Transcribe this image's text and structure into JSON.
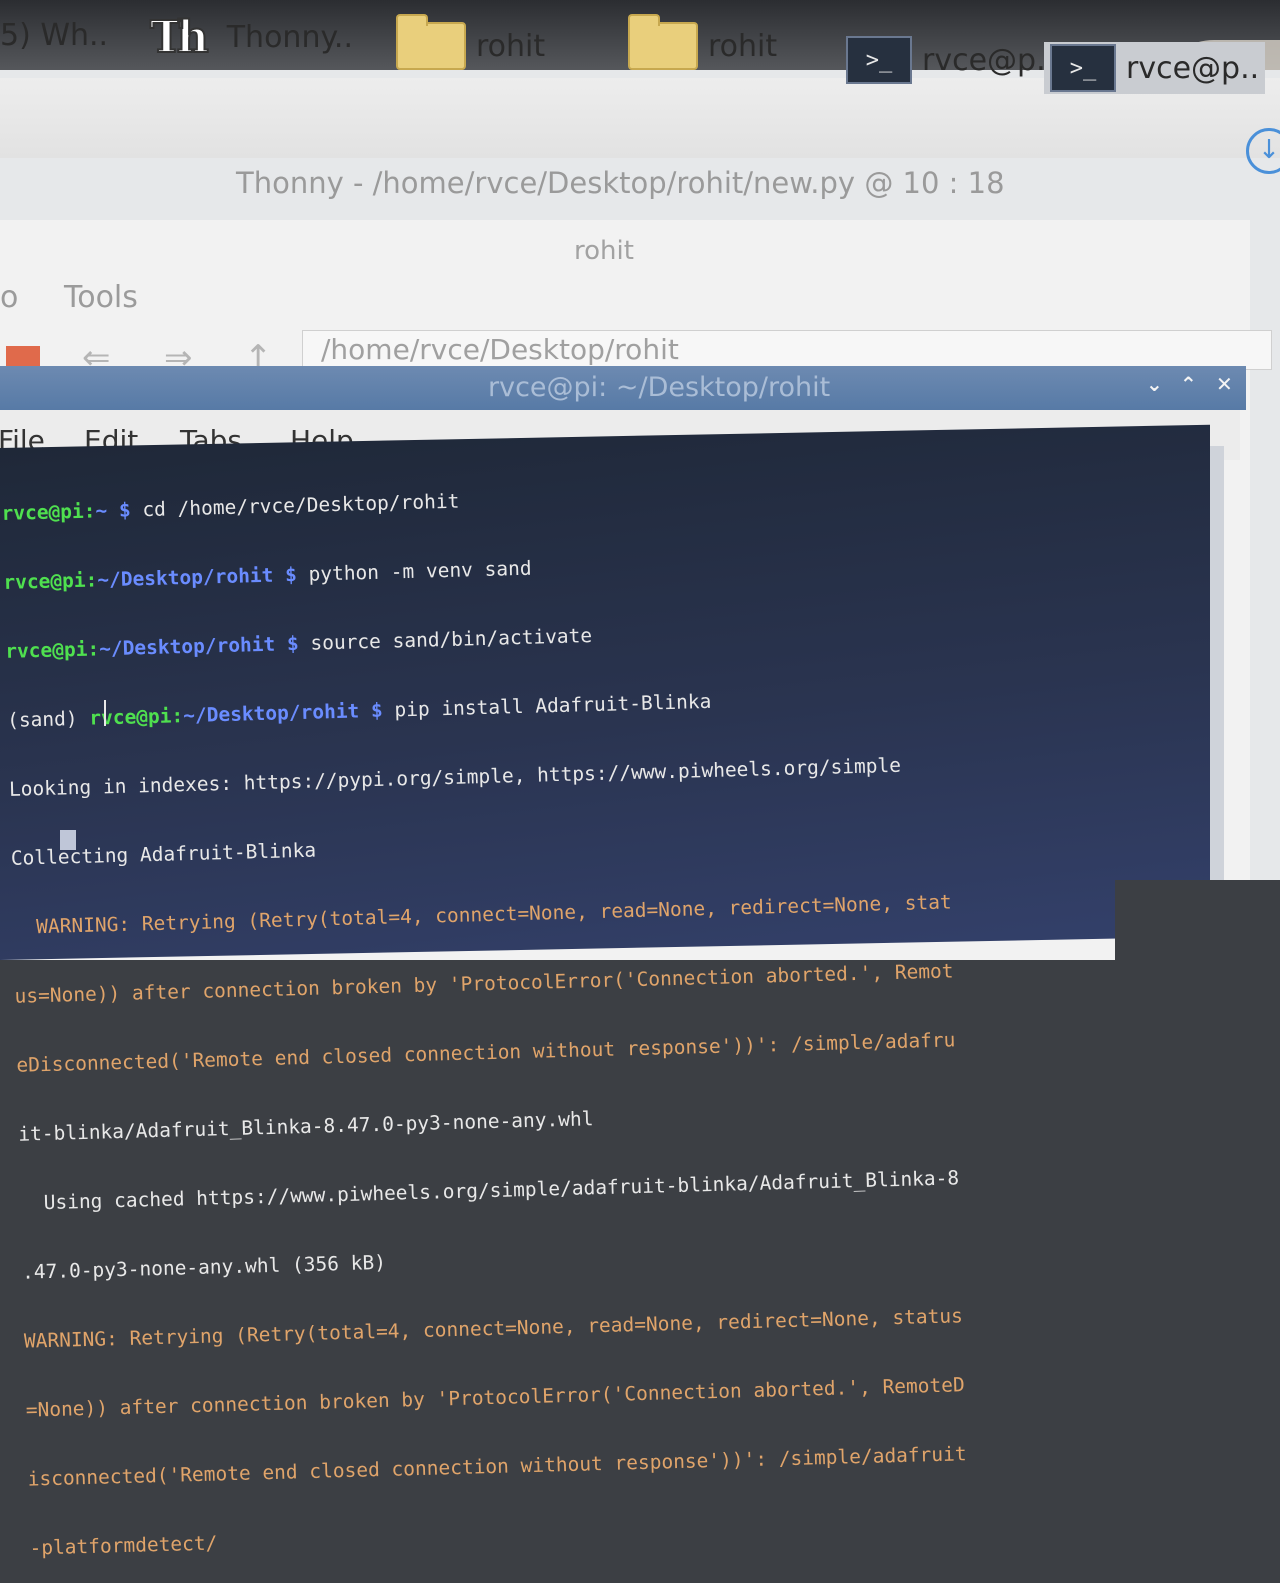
{
  "taskbar": {
    "items": [
      {
        "label": "5) Wh..",
        "icon": "window-icon"
      },
      {
        "label": "Thonny..",
        "icon": "thonny-icon"
      },
      {
        "label": "rohit",
        "icon": "folder-icon"
      },
      {
        "label": "rohit",
        "icon": "folder-icon"
      },
      {
        "label": "rvce@p..",
        "icon": "terminal-icon"
      },
      {
        "label": "rvce@p..",
        "icon": "terminal-icon"
      }
    ],
    "terminal_glyph": ">_",
    "thonny_glyph": "Th"
  },
  "thonny": {
    "title": "Thonny  -  /home/rvce/Desktop/rohit/new.py  @  10 : 18"
  },
  "file_manager": {
    "title": "rohit",
    "menu": {
      "go": "o",
      "tools": "Tools"
    },
    "path": "/home/rvce/Desktop/rohit",
    "nav": {
      "back": "⇐",
      "forward": "⇒",
      "up": "↑"
    }
  },
  "terminal": {
    "title": "rvce@pi: ~/Desktop/rohit",
    "window_buttons": {
      "minimize": "⌄",
      "maximize": "⌃",
      "close": "✕"
    },
    "menu": [
      "File",
      "Edit",
      "Tabs",
      "Help"
    ],
    "prompt_user": "rvce@pi",
    "lines": [
      {
        "prompt": "rvce@pi:",
        "path": "~ $",
        "cmd": " cd /home/rvce/Desktop/rohit"
      },
      {
        "prompt": "rvce@pi:",
        "path": "~/Desktop/rohit $",
        "cmd": " python -m venv sand"
      },
      {
        "prompt": "rvce@pi:",
        "path": "~/Desktop/rohit $",
        "cmd": " source sand/bin/activate"
      },
      {
        "venv": "(sand) ",
        "prompt": "rvce@pi:",
        "path": "~/Desktop/rohit $",
        "cmd": " pip install Adafruit-Blinka"
      },
      {
        "text": "Looking in indexes: https://pypi.org/simple, https://www.piwheels.org/simple"
      },
      {
        "text": "Collecting Adafruit-Blinka"
      },
      {
        "warn": "  WARNING: Retrying (Retry(total=4, connect=None, read=None, redirect=None, stat"
      },
      {
        "warn": "us=None)) after connection broken by 'ProtocolError('Connection aborted.', Remot"
      },
      {
        "warn": "eDisconnected('Remote end closed connection without response'))': /simple/adafru"
      },
      {
        "text": "it-blinka/Adafruit_Blinka-8.47.0-py3-none-any.whl"
      },
      {
        "text": "  Using cached https://www.piwheels.org/simple/adafruit-blinka/Adafruit_Blinka-8"
      },
      {
        "text": ".47.0-py3-none-any.whl (356 kB)"
      },
      {
        "warn": "WARNING: Retrying (Retry(total=4, connect=None, read=None, redirect=None, status"
      },
      {
        "warn": "=None)) after connection broken by 'ProtocolError('Connection aborted.', RemoteD"
      },
      {
        "warn": "isconnected('Remote end closed connection without response'))': /simple/adafruit"
      },
      {
        "warn": "-platformdetect/"
      }
    ]
  },
  "colors": {
    "prompt_green": "#4fe04f",
    "path_blue": "#6a8cff",
    "warning_orange": "#e0a46a",
    "titlebar_blue": "#577aa6"
  }
}
